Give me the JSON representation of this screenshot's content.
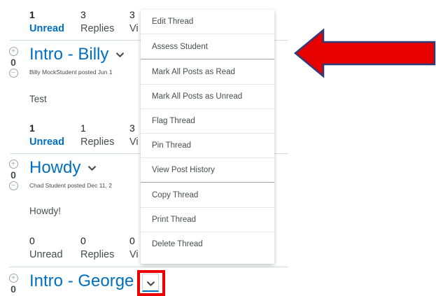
{
  "colors": {
    "link": "#006fbf",
    "highlight": "#ee0000",
    "arrow": "#e60000"
  },
  "threads": [
    {
      "stats": [
        {
          "num": "1",
          "label": "Unread"
        },
        {
          "num": "3",
          "label": "Replies"
        },
        {
          "num": "3",
          "label": "Vi"
        }
      ]
    },
    {
      "score": "0",
      "title": "Intro - Billy",
      "poster": "Billy MockStudent posted Jun 1",
      "body": "Test",
      "stats": [
        {
          "num": "1",
          "label": "Unread"
        },
        {
          "num": "1",
          "label": "Replies"
        },
        {
          "num": "3",
          "label": "Vi"
        }
      ]
    },
    {
      "score": "0",
      "title": "Howdy",
      "poster": "Chad Student posted Dec 11, 2",
      "body": "Howdy!",
      "stats": [
        {
          "num": "0",
          "label": "Unread"
        },
        {
          "num": "0",
          "label": "Replies"
        },
        {
          "num": "0",
          "label": "Vi"
        }
      ]
    },
    {
      "score": "0",
      "title": "Intro - George"
    }
  ],
  "menu": {
    "items": [
      "Edit Thread",
      "Assess Student",
      "Mark All Posts as Read",
      "Mark All Posts as Unread",
      "Flag Thread",
      "Pin Thread",
      "View Post History",
      "Copy Thread",
      "Print Thread",
      "Delete Thread"
    ]
  },
  "icons": {
    "vote_up": "plus-circle-icon",
    "vote_down": "minus-circle-icon",
    "menu_toggle": "chevron-down-icon",
    "annotation": "red-arrow"
  }
}
